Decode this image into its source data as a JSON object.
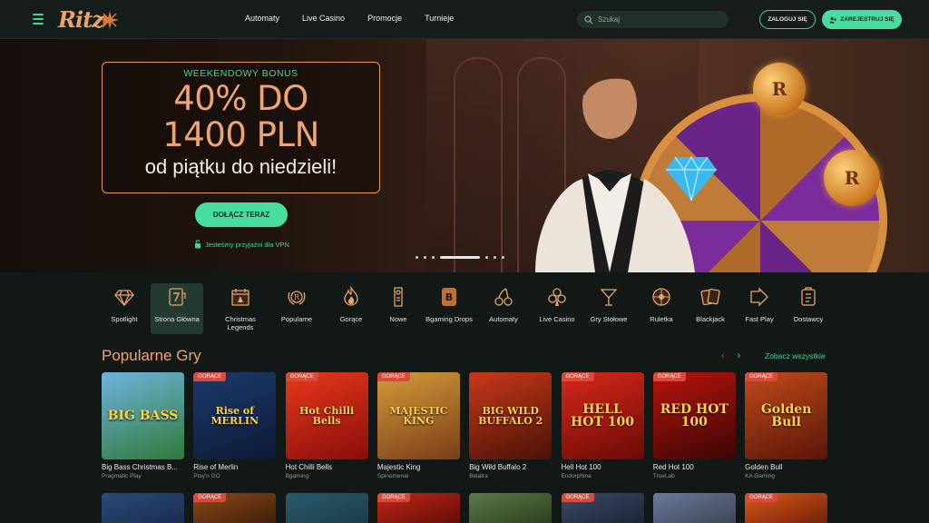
{
  "header": {
    "logo": "Ritz",
    "nav": [
      "Automaty",
      "Live Casino",
      "Promocje",
      "Turnieje"
    ],
    "search_placeholder": "Szukaj",
    "login_label": "ZALOGUJ SIĘ",
    "register_label": "ZAREJESTRUJ SIĘ"
  },
  "hero": {
    "kicker": "WEEKENDOWY BONUS",
    "amount_line1": "40% DO",
    "amount_line2": "1400 PLN",
    "subtitle": "od piątku do niedzieli!",
    "cta": "DOŁĄCZ TERAZ",
    "vpn_note": "Jesteśmy przyjaźni dla VPN",
    "slides_total": 7,
    "slide_active": 4
  },
  "categories": [
    {
      "label": "Spotlight",
      "icon": "diamond-icon"
    },
    {
      "label": "Strona Główna",
      "icon": "slot-seven-icon",
      "active": true
    },
    {
      "label": "Christmas Legends",
      "icon": "calendar-icon"
    },
    {
      "label": "Popularne",
      "icon": "laurel-badge-icon"
    },
    {
      "label": "Gorące",
      "icon": "flame-icon"
    },
    {
      "label": "Nowe",
      "icon": "door-tag-icon"
    },
    {
      "label": "Bgaming Drops",
      "icon": "b-badge-icon"
    },
    {
      "label": "Automaty",
      "icon": "cherries-icon"
    },
    {
      "label": "Live Casino",
      "icon": "clubs-icon"
    },
    {
      "label": "Gry Stołowe",
      "icon": "cocktail-icon"
    },
    {
      "label": "Ruletka",
      "icon": "roulette-icon"
    },
    {
      "label": "Blackjack",
      "icon": "cards-icon"
    },
    {
      "label": "Fast Play",
      "icon": "fast-arrow-icon"
    },
    {
      "label": "Dostawcy",
      "icon": "provider-icon"
    }
  ],
  "popular": {
    "title": "Popularne Gry",
    "see_all": "Zobacz wszystkie",
    "badge_label": "GORĄCE",
    "games": [
      {
        "name": "Big Bass Christmas B...",
        "provider": "Pragmatic Play",
        "hot": false,
        "art": "BIG BASS",
        "colors": [
          "#6fb3de",
          "#2f7a3a"
        ]
      },
      {
        "name": "Rise of Merlin",
        "provider": "Play'n GO",
        "hot": true,
        "art": "Rise of MERLIN",
        "colors": [
          "#1c3a6a",
          "#0c1a38"
        ]
      },
      {
        "name": "Hot Chilli Bells",
        "provider": "Bgaming",
        "hot": true,
        "art": "Hot Chilli Bells",
        "colors": [
          "#e8381c",
          "#8a0e0a"
        ]
      },
      {
        "name": "Majestic King",
        "provider": "Spinomenal",
        "hot": true,
        "art": "MAJESTIC KING",
        "colors": [
          "#d49a3a",
          "#7a3e18"
        ]
      },
      {
        "name": "Big Wild Buffalo 2",
        "provider": "Belatra",
        "hot": false,
        "art": "BIG WILD BUFFALO 2",
        "colors": [
          "#c8381a",
          "#4a1208"
        ]
      },
      {
        "name": "Hell Hot 100",
        "provider": "Endorphina",
        "hot": true,
        "art": "HELL HOT 100",
        "colors": [
          "#d8281a",
          "#6a0a06"
        ]
      },
      {
        "name": "Red Hot 100",
        "provider": "TrueLab",
        "hot": true,
        "art": "RED HOT 100",
        "colors": [
          "#b8140c",
          "#3a0604"
        ]
      },
      {
        "name": "Golden Bull",
        "provider": "KA Gaming",
        "hot": true,
        "art": "Golden Bull",
        "colors": [
          "#c04a1a",
          "#5a1608"
        ]
      }
    ]
  },
  "row2": {
    "badge_label": "GORĄCE",
    "tiles": [
      {
        "hot": false,
        "colors": [
          "#2a4a7a",
          "#1a2a4a"
        ]
      },
      {
        "hot": true,
        "colors": [
          "#8a4a1a",
          "#3a1a0a"
        ]
      },
      {
        "hot": false,
        "colors": [
          "#2a5a6a",
          "#1a3a4a"
        ]
      },
      {
        "hot": true,
        "colors": [
          "#c0281a",
          "#5a0a06"
        ]
      },
      {
        "hot": false,
        "colors": [
          "#5a7a4a",
          "#2a3a1a"
        ]
      },
      {
        "hot": true,
        "colors": [
          "#3a4a6a",
          "#1a2230"
        ]
      },
      {
        "hot": false,
        "colors": [
          "#6a7a9a",
          "#3a4050"
        ]
      },
      {
        "hot": true,
        "colors": [
          "#d85a1a",
          "#6a1a06"
        ]
      }
    ]
  }
}
